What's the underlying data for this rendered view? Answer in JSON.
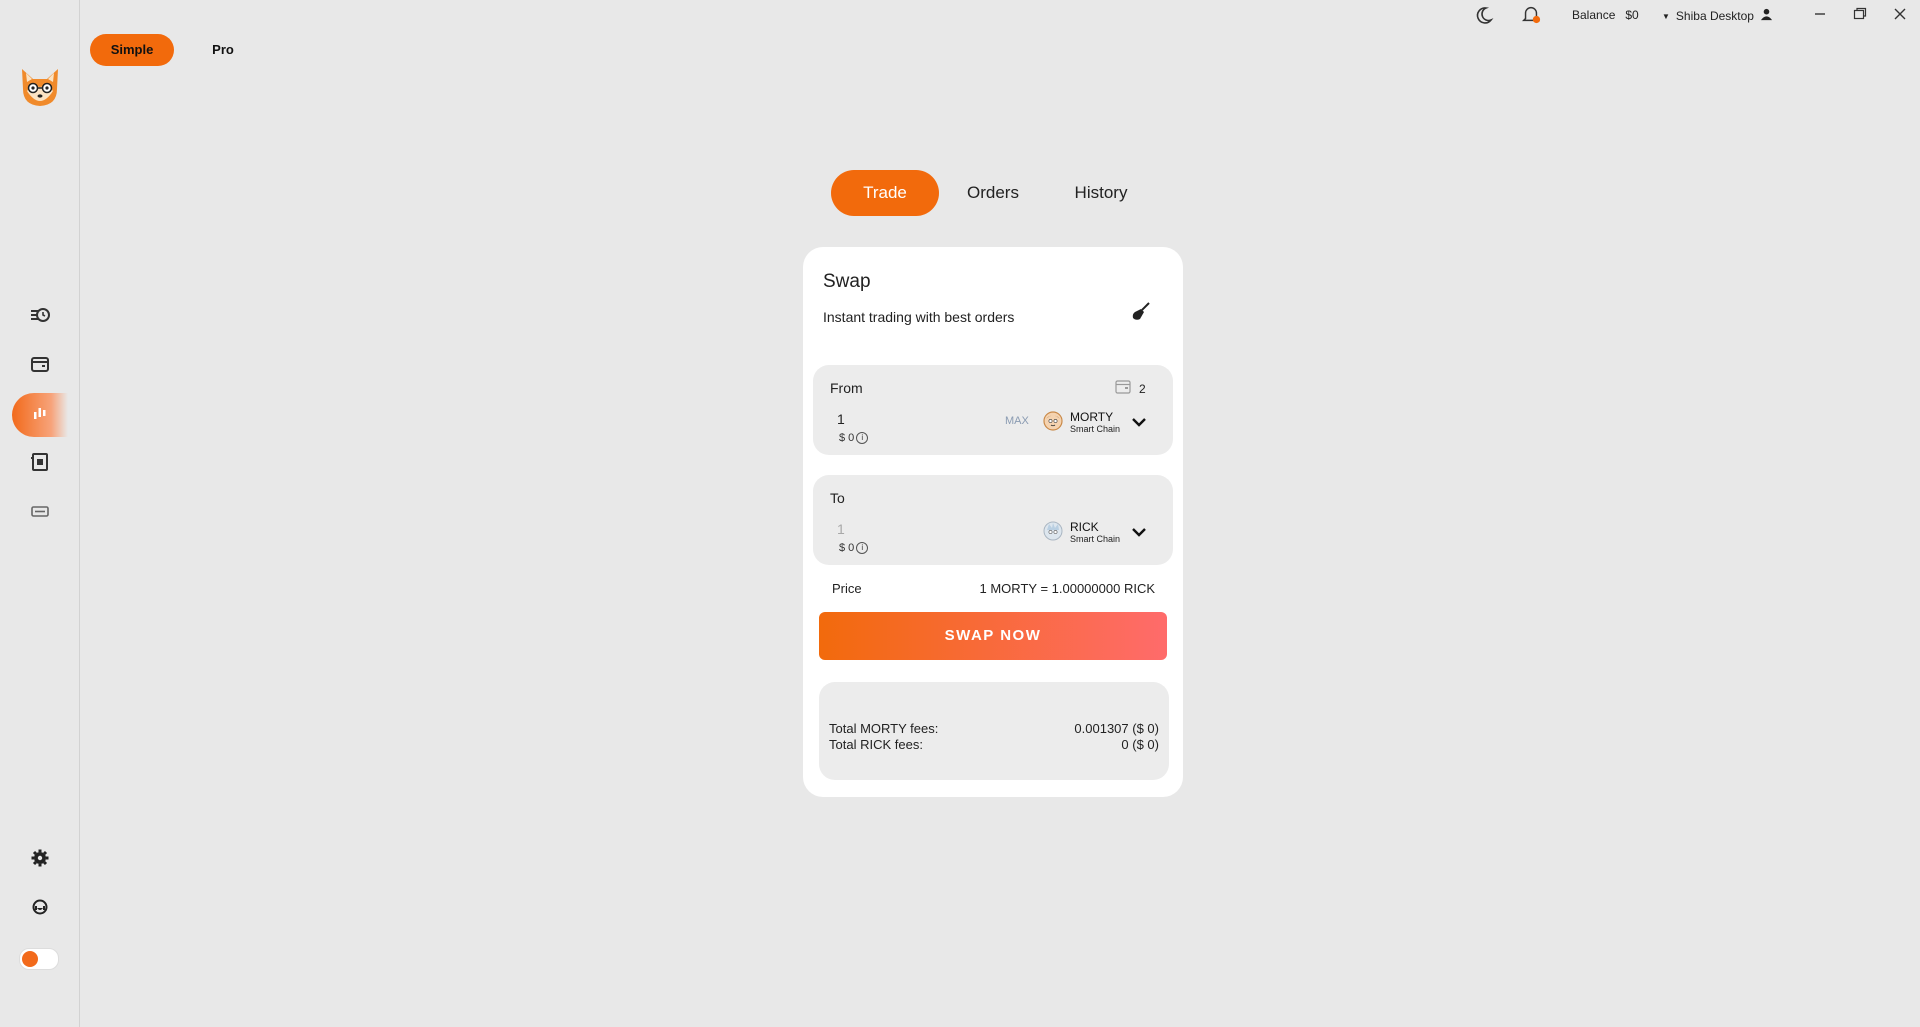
{
  "mode_tabs": {
    "simple": "Simple",
    "pro": "Pro"
  },
  "topbar": {
    "balance_label": "Balance",
    "balance_value": "$0",
    "account": "Shiba Desktop"
  },
  "trade_tabs": {
    "trade": "Trade",
    "orders": "Orders",
    "history": "History"
  },
  "swap": {
    "title": "Swap",
    "subtitle": "Instant trading with best orders",
    "from": {
      "label": "From",
      "wallet_count": "2",
      "amount": "1",
      "usd": "$ 0",
      "max": "MAX",
      "coin": "MORTY",
      "chain": "Smart Chain"
    },
    "to": {
      "label": "To",
      "amount": "1",
      "usd": "$ 0",
      "coin": "RICK",
      "chain": "Smart Chain"
    },
    "price_label": "Price",
    "price_value": "1 MORTY = 1.00000000 RICK",
    "swap_button": "SWAP NOW",
    "fees": [
      {
        "label": "Total MORTY fees:",
        "value": "0.001307 ($ 0)"
      },
      {
        "label": "Total RICK fees:",
        "value": "0 ($ 0)"
      }
    ]
  },
  "colors": {
    "accent": "#f26a0c",
    "accent_end": "#ff6b6b",
    "background": "#e8e8e8"
  }
}
